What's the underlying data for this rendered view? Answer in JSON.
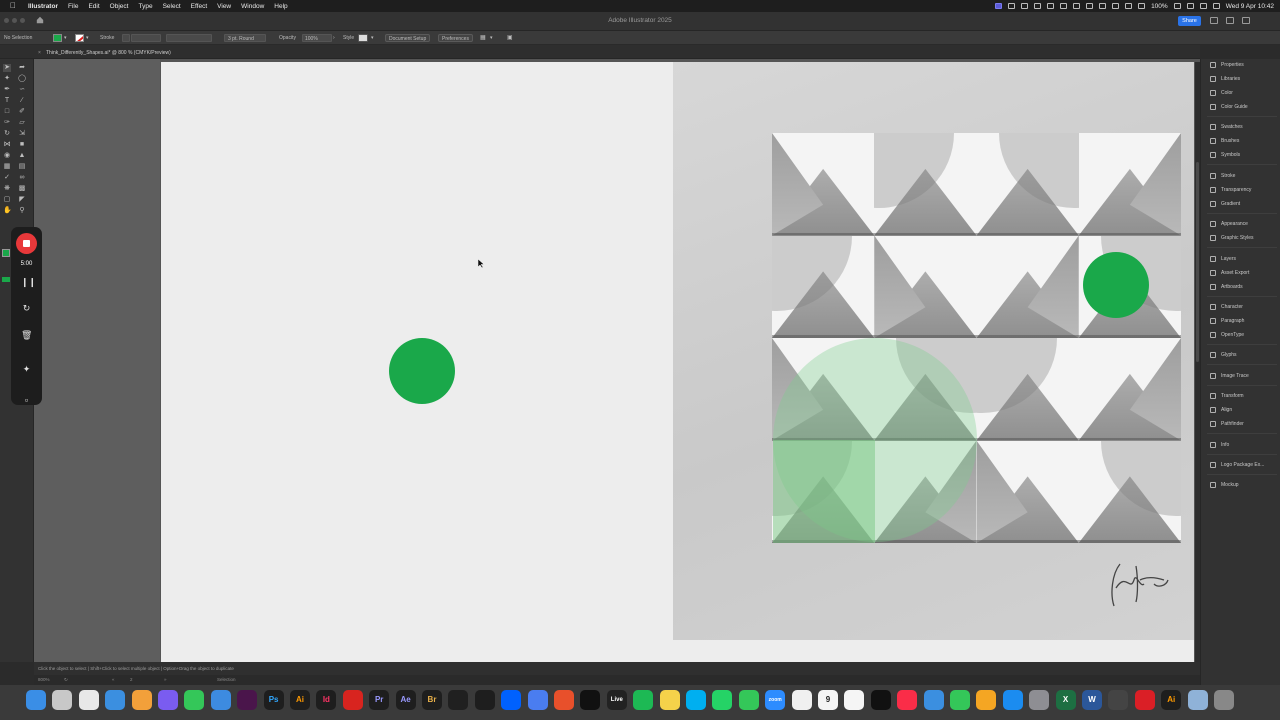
{
  "menubar": {
    "app_name": "Illustrator",
    "items": [
      "File",
      "Edit",
      "Object",
      "Type",
      "Select",
      "Effect",
      "View",
      "Window",
      "Help"
    ],
    "battery": "100%",
    "datetime": "Wed 9 Apr  10:42"
  },
  "titlebar": {
    "title": "Adobe Illustrator 2025",
    "share_label": "Share"
  },
  "controlbar": {
    "selection": "No Selection",
    "stroke_label": "Stroke",
    "brush": "3 pt. Round",
    "opacity_label": "Opacity",
    "opacity_value": "100%",
    "style_label": "Style",
    "document_setup": "Document Setup",
    "preferences": "Preferences",
    "fill_color": "#1aa84a"
  },
  "document": {
    "tab_label": "Think_Differently_Shapes.ai* @ 800 % (CMYK/Preview)"
  },
  "recorder": {
    "time": "5:00"
  },
  "panels": {
    "items": [
      "Properties",
      "Libraries",
      "Color",
      "Color Guide",
      "Swatches",
      "Brushes",
      "Symbols",
      "Stroke",
      "Transparency",
      "Gradient",
      "Appearance",
      "Graphic Styles",
      "Layers",
      "Asset Export",
      "Artboards",
      "Character",
      "Paragraph",
      "OpenType",
      "Glyphs",
      "Image Trace",
      "Transform",
      "Align",
      "Pathfinder",
      "Info",
      "Logo Package Ex...",
      "Mockup"
    ]
  },
  "statusbar": {
    "hint": "Click the object to select  |  Shift+Click to select multiple object  |  Option+Drag the object to duplicate",
    "zoom": "800%",
    "artboard_nav": "2",
    "tool": "Selection"
  },
  "dock": {
    "apps": [
      "Finder",
      "Launchpad",
      "Chrome",
      "Safari",
      "Pages",
      "Arc",
      "Messages",
      "Mail",
      "Slack",
      "Photoshop",
      "Illustrator",
      "InDesign",
      "Acrobat",
      "Premiere Pro",
      "After Effects",
      "Bridge",
      "ChatGPT",
      "Figma",
      "Dropbox",
      "Shortcuts",
      "Office",
      "Unity",
      "Live",
      "Spotify",
      "Notes",
      "Skype",
      "WhatsApp",
      "FaceTime",
      "Zoom",
      "Photos",
      "Calendar",
      "Reminders",
      "Apple TV",
      "Music",
      "Keynote",
      "Numbers",
      "Pages Doc",
      "App Store",
      "Settings",
      "Excel",
      "Word",
      "Calculator",
      "Creative Cloud",
      "Illustrator Alt",
      "Downloads",
      "Trash"
    ],
    "calendar_day": "9",
    "live_label": "Live",
    "zoom_label": "zoom"
  },
  "colors": {
    "accent_green": "#1aa84a",
    "record_red": "#e8383a",
    "share_blue": "#2a73e8"
  }
}
